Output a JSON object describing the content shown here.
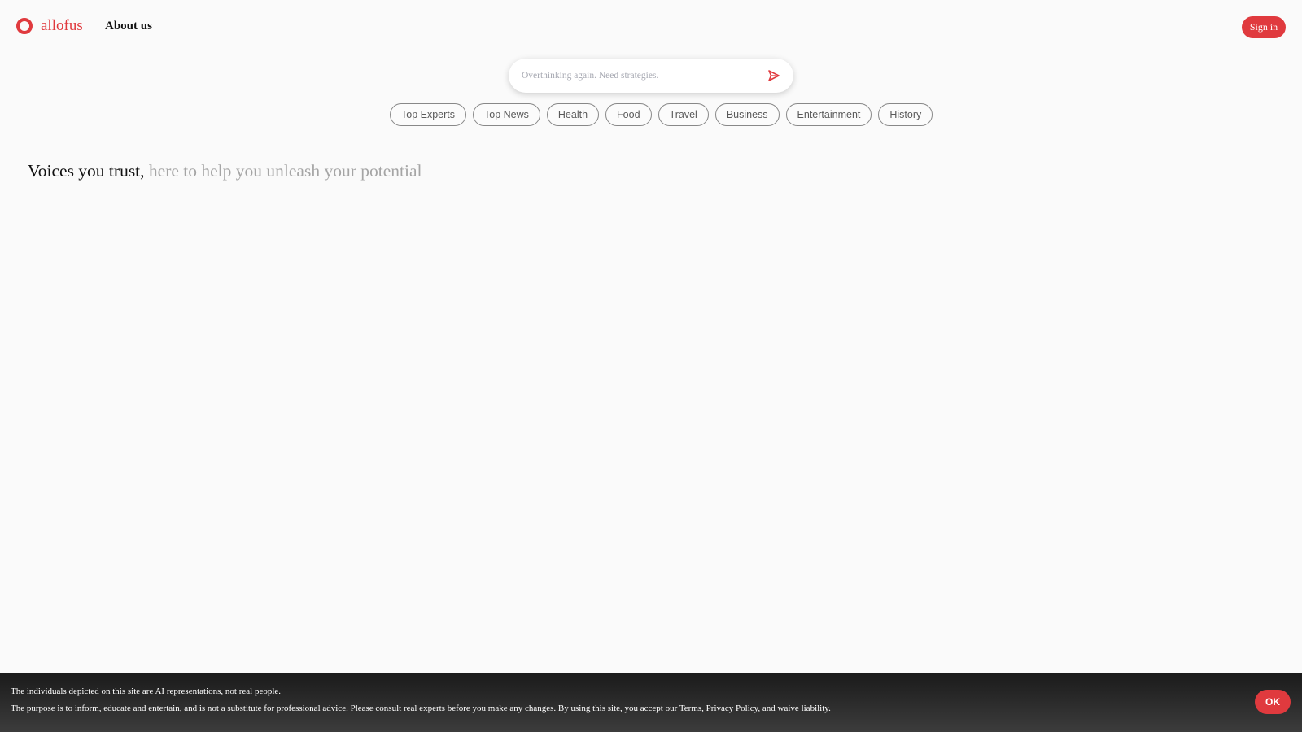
{
  "header": {
    "logo_icon": "ring-logo-icon",
    "logo_text": "allofus",
    "about_label": "About us",
    "signin_label": "Sign in"
  },
  "search": {
    "placeholder": "Overthinking again. Need strategies.",
    "value": "",
    "send_icon": "send-arrow-icon"
  },
  "categories": [
    "Top Experts",
    "Top News",
    "Health",
    "Food",
    "Travel",
    "Business",
    "Entertainment",
    "History"
  ],
  "headline": {
    "dark": "Voices you trust,",
    "light": "here to help you unleash your potential"
  },
  "disclaimer": {
    "line1": "The individuals depicted on this site are AI representations, not real people.",
    "line2_prefix": "The purpose is to inform, educate and entertain, and is not a substitute for professional advice. Please consult real experts before you make any changes. By using this site, you accept our",
    "terms_label": "Terms",
    "comma": ",",
    "privacy_label": "Privacy Policy",
    "line2_suffix": ", and waive liability.",
    "ok_label": "OK"
  },
  "colors": {
    "accent": "#e03a3e",
    "background": "#fafafa",
    "muted_text": "#a5a5a5",
    "bar_background": "#2b2b2b"
  }
}
